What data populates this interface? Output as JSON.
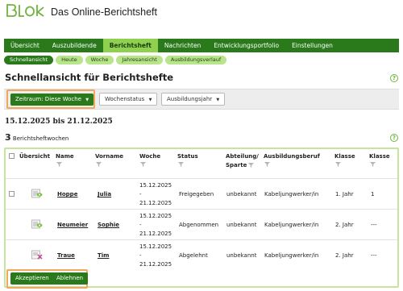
{
  "brand": {
    "logo_text": "Blok",
    "app_title": "Das Online-Berichtsheft",
    "accent": "#2a7a1c",
    "highlight": "#f0a95a"
  },
  "main_nav": [
    {
      "label": "Übersicht"
    },
    {
      "label": "Auszubildende"
    },
    {
      "label": "Berichtsheft",
      "active": true
    },
    {
      "label": "Nachrichten"
    },
    {
      "label": "Entwicklungsportfolio"
    },
    {
      "label": "Einstellungen"
    }
  ],
  "sub_nav": [
    {
      "label": "Schnellansicht",
      "active": true
    },
    {
      "label": "Heute"
    },
    {
      "label": "Woche"
    },
    {
      "label": "Jahresansicht"
    },
    {
      "label": "Ausbildungsverlauf"
    }
  ],
  "page_title": "Schnellansicht für Berichtshefte",
  "filters": {
    "zeitraum": "Zeitraum: Diese Woche",
    "wochenstatus": "Wochenstatus",
    "ausbildungsjahr": "Ausbildungsjahr"
  },
  "date_range": "15.12.2025 bis 21.12.2025",
  "count": {
    "number": "3",
    "label": "Berichtsheftwochen"
  },
  "table": {
    "headers": {
      "uebersicht": "Übersicht",
      "name": "Name",
      "vorname": "Vorname",
      "woche": "Woche",
      "status": "Status",
      "abteilung_1": "Abteilung/",
      "abteilung_2": "Sparte",
      "beruf": "Ausbildungsberuf",
      "klasse1": "Klasse",
      "klasse2": "Klasse"
    },
    "rows": [
      {
        "name": "Hoppe",
        "vorname": "Julia",
        "woche_1": "15.12.2025",
        "woche_2": "-",
        "woche_3": "21.12.2025",
        "status": "Freigegeben",
        "abteilung": "unbekannt",
        "beruf": "Kabeljungwerker/in",
        "klasse1": "1. Jahr",
        "klasse2": "1"
      },
      {
        "name": "Neumeier",
        "vorname": "Sophie",
        "woche_1": "15.12.2025",
        "woche_2": "-",
        "woche_3": "21.12.2025",
        "status": "Abgenommen",
        "abteilung": "unbekannt",
        "beruf": "Kabeljungwerker/in",
        "klasse1": "2. Jahr",
        "klasse2": "---"
      },
      {
        "name": "Traue",
        "vorname": "Tim",
        "woche_1": "15.12.2025",
        "woche_2": "-",
        "woche_3": "21.12.2025",
        "status": "Abgelehnt",
        "abteilung": "unbekannt",
        "beruf": "Kabeljungwerker/in",
        "klasse1": "2. Jahr",
        "klasse2": "---"
      }
    ]
  },
  "actions": {
    "accept": "Akzeptieren",
    "reject": "Ablehnen"
  }
}
